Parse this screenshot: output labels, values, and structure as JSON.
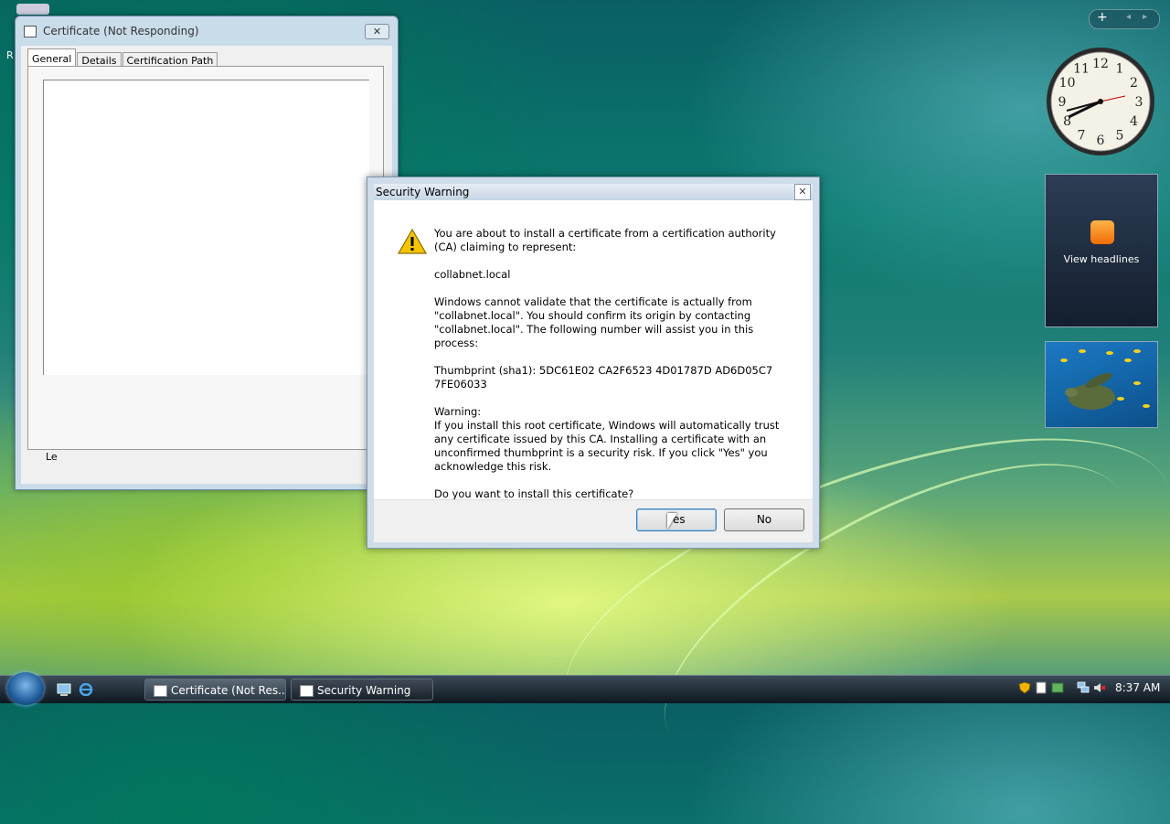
{
  "desktop": {
    "recycle_label": "R"
  },
  "cert_window": {
    "title": "Certificate (Not Responding)",
    "close_label": "✕",
    "tabs": [
      "General",
      "Details",
      "Certification Path"
    ],
    "partial_label": "Le"
  },
  "security_warning": {
    "title": "Security Warning",
    "close_label": "✕",
    "line1": "You are about to install a certificate from a certification authority (CA) claiming to represent:",
    "ca_name": "collabnet.local",
    "para2": "Windows cannot validate that the certificate is actually from \"collabnet.local\". You should confirm its origin by contacting \"collabnet.local\". The following number will assist you in this process:",
    "thumbprint": "Thumbprint (sha1): 5DC61E02 CA2F6523 4D01787D AD6D05C7 7FE06033",
    "warning_heading": "Warning:",
    "warning_text": "If you install this root certificate, Windows will automatically trust any certificate issued by this CA. Installing a certificate with an unconfirmed thumbprint is a security risk. If you click \"Yes\" you acknowledge this risk.",
    "question": "Do you want to install this certificate?",
    "yes_label": "Yes",
    "no_label": "No"
  },
  "gadgets": {
    "control_add": "+",
    "control_prev": "◂",
    "control_next": "▸",
    "feed_label": "View headlines",
    "clock_numbers": [
      "12",
      "1",
      "2",
      "3",
      "4",
      "5",
      "6",
      "7",
      "8",
      "9",
      "10",
      "11"
    ]
  },
  "taskbar": {
    "tasks": [
      {
        "label": "Certificate (Not Res..."
      },
      {
        "label": "Security Warning"
      }
    ],
    "time": "8:37 AM"
  },
  "colors": {
    "warning_yellow": "#f5c400",
    "feed_orange": "#f07c06"
  }
}
